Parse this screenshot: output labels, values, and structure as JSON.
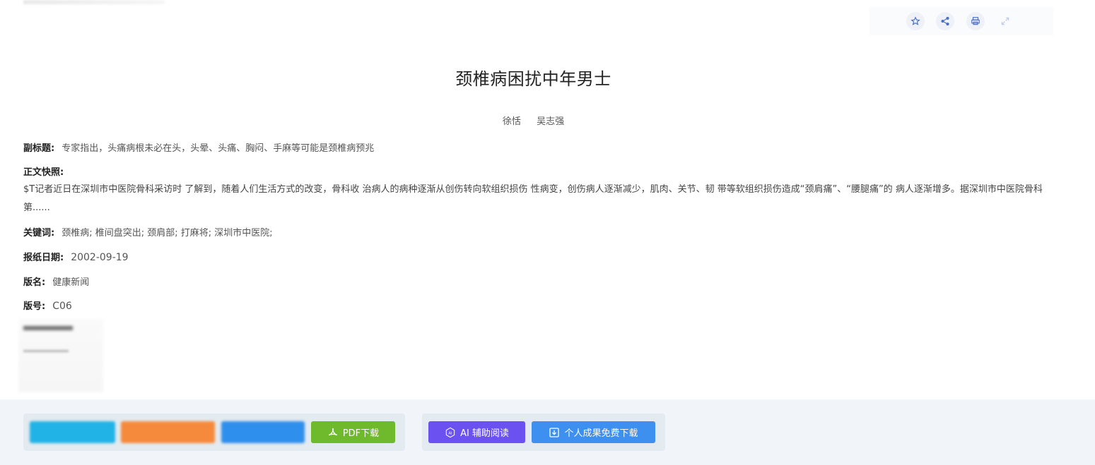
{
  "article": {
    "title": "颈椎病困扰中年男士",
    "authors": [
      "徐恬",
      "吴志强"
    ],
    "subtitle_label": "副标题:",
    "subtitle": "专家指出，头痛病根未必在头，头晕、头痛、胸闷、手麻等可能是颈椎病预兆",
    "snapshot_label": "正文快照:",
    "snapshot": "$T记者近日在深圳市中医院骨科采访时 了解到，随着人们生活方式的改变，骨科收 治病人的病种逐渐从创伤转向软组织损伤 性病变，创伤病人逐渐减少，肌肉、关节、韧 带等软组织损伤造成“颈肩痛”、“腰腿痛”的 病人逐渐增多。据深圳市中医院骨科第......",
    "keywords_label": "关键词:",
    "keywords": "颈椎病;  椎间盘突出;  颈肩部;  打麻将;  深圳市中医院;",
    "date_label": "报纸日期:",
    "date": "2002-09-19",
    "edition_name_label": "版名:",
    "edition_name": "健康新闻",
    "edition_no_label": "版号:",
    "edition_no": "C06"
  },
  "toolbar": {
    "icons": [
      "star-icon",
      "share-icon",
      "print-icon",
      "expand-icon"
    ]
  },
  "footer": {
    "pdf_download": "PDF下载",
    "ai_reading": "AI 辅助阅读",
    "personal_download": "个人成果免费下载"
  },
  "colors": {
    "btn_cyan": "#22b3e6",
    "btn_orange": "#f68a3c",
    "btn_blue": "#2f8fec",
    "btn_pdf": "#6fba2c",
    "btn_ai": "#6b52f0",
    "btn_personal": "#3d8ff0"
  }
}
